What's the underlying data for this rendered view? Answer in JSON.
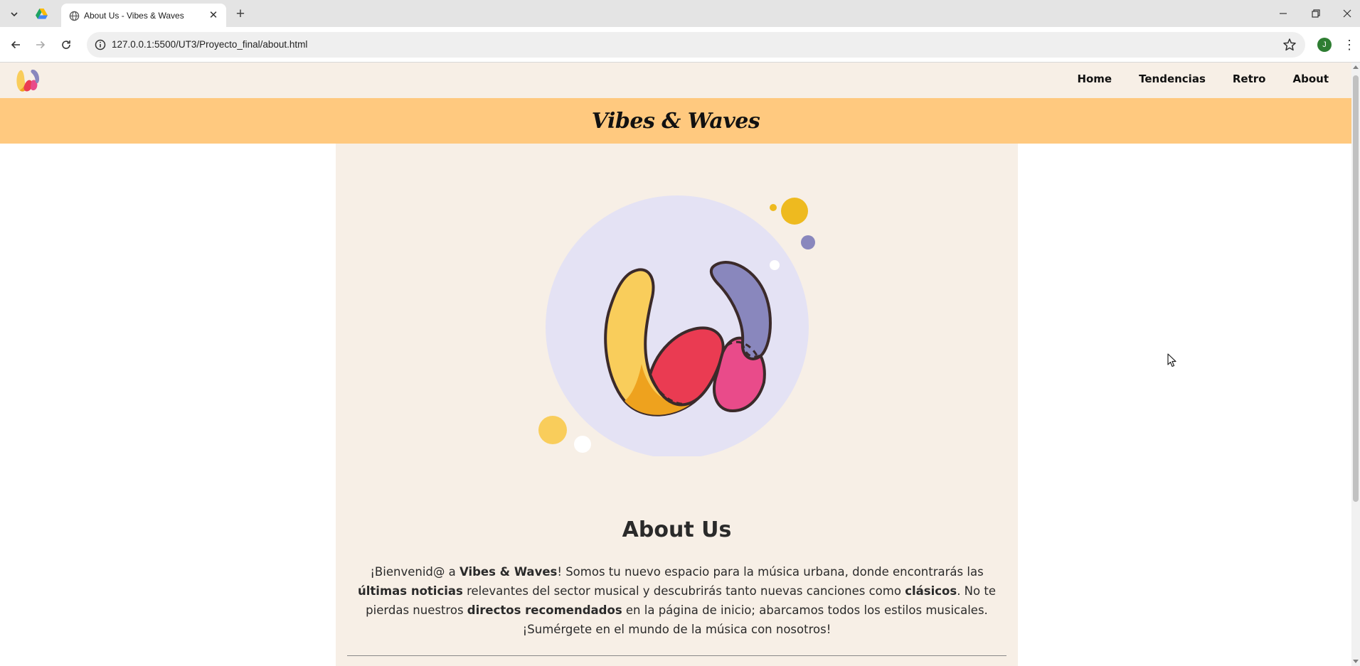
{
  "browser": {
    "tab_title": "About Us - Vibes & Waves",
    "url": "127.0.0.1:5500/UT3/Proyecto_final/about.html",
    "profile_initial": "J"
  },
  "site": {
    "nav": [
      "Home",
      "Tendencias",
      "Retro",
      "About"
    ],
    "banner_title": "Vibes & Waves",
    "about_title": "About Us",
    "about_text": {
      "p1": "¡Bienvenid@ a ",
      "b1": "Vibes & Waves",
      "p2": "! Somos tu nuevo espacio para la música urbana, donde encontrarás las ",
      "b2": "últimas noticias",
      "p3": " relevantes del sector musical y descubrirás tanto nuevas canciones como ",
      "b3": "clásicos",
      "p4": ". No te pierdas nuestros ",
      "b4": "directos recomendados",
      "p5": " en la página de inicio; abarcamos todos los estilos musicales. ¡Sumérgete en el mundo de la música con nosotros!"
    }
  },
  "colors": {
    "banner": "#ffc97f",
    "content_bg": "#f7efe6",
    "logo_yellow": "#f9cd5b",
    "logo_orange": "#eea21e",
    "logo_red": "#ea3b52",
    "logo_pink": "#e94b8a",
    "logo_purple": "#8987bd",
    "hero_circle": "#e4e2f4"
  }
}
